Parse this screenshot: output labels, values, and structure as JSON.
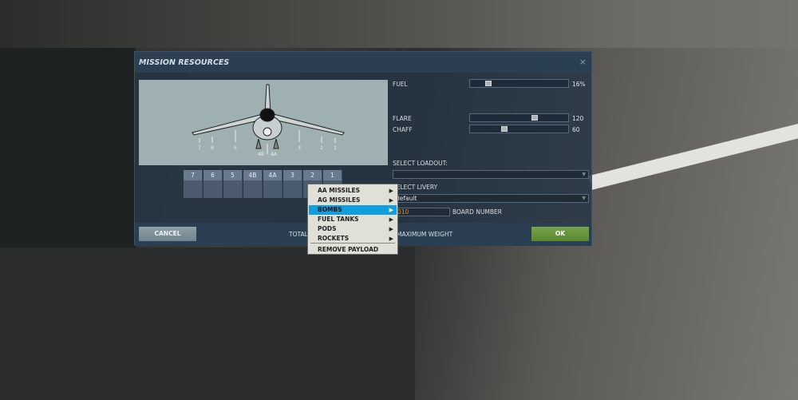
{
  "dialog": {
    "title": "MISSION RESOURCES",
    "close_icon": "×"
  },
  "pylons": {
    "diagram_labels": [
      "7",
      "6",
      "5",
      "4B",
      "4A",
      "3",
      "2",
      "1"
    ],
    "slots": [
      "7",
      "6",
      "5",
      "4B",
      "4A",
      "3",
      "2",
      "1"
    ]
  },
  "fuel": {
    "label": "FUEL",
    "value": "16%",
    "fraction": 0.16
  },
  "flare": {
    "label": "FLARE",
    "value": "120",
    "fraction": 0.72
  },
  "chaff": {
    "label": "CHAFF",
    "value": "60",
    "fraction": 0.36
  },
  "loadout": {
    "label": "SELECT LOADOUT:",
    "value": ""
  },
  "livery": {
    "label": "SELECT LIVERY",
    "value": "default"
  },
  "board": {
    "value": "010",
    "label": "BOARD NUMBER"
  },
  "footer": {
    "cancel": "CANCEL",
    "total": "TOTAL",
    "max_weight": "MAXIMUM WEIGHT",
    "ok": "OK"
  },
  "menu": {
    "items": [
      "AA MISSILES",
      "AG MISSILES",
      "BOMBS",
      "FUEL TANKS",
      "PODS",
      "ROCKETS"
    ],
    "selected": "BOMBS",
    "remove": "REMOVE PAYLOAD"
  }
}
